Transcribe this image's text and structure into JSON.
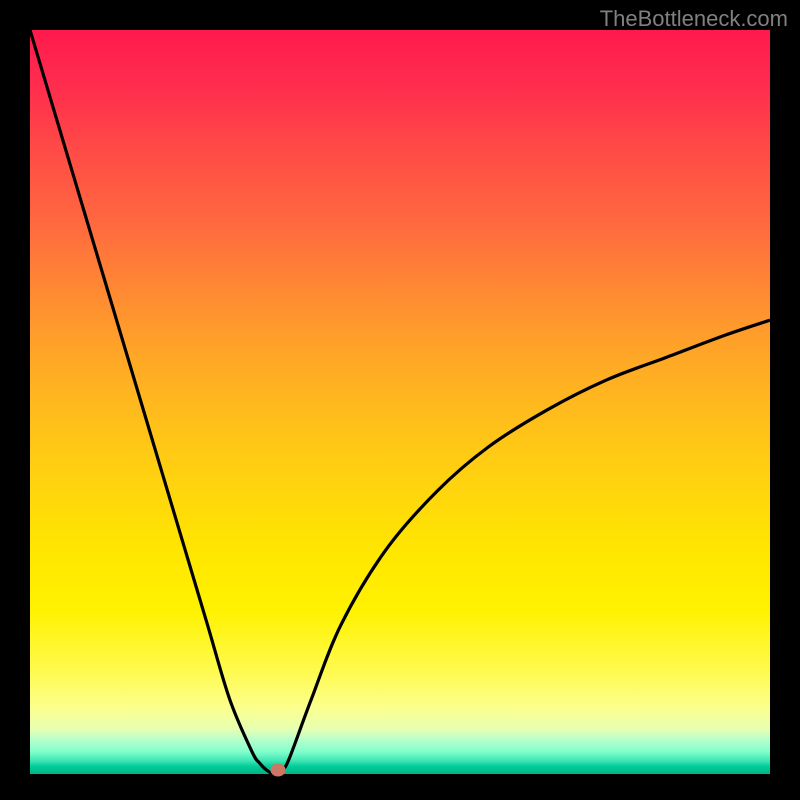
{
  "watermark": "TheBottleneck.com",
  "chart_data": {
    "type": "line",
    "title": "",
    "xlabel": "",
    "ylabel": "",
    "x": [
      0,
      3,
      6,
      9,
      12,
      15,
      18,
      21,
      24,
      27,
      30,
      31,
      32,
      33,
      34,
      35,
      38,
      42,
      48,
      55,
      62,
      70,
      78,
      86,
      94,
      100
    ],
    "values": [
      100,
      90,
      80,
      70,
      60,
      50,
      40,
      30,
      20,
      10,
      3,
      1.5,
      0.5,
      0,
      0.5,
      2,
      10,
      20,
      30,
      38,
      44,
      49,
      53,
      56,
      59,
      61
    ],
    "curve_vertex_x": 33,
    "curve_vertex_y": 0,
    "marker": {
      "x": 33.5,
      "y": 0.5
    },
    "xlim": [
      0,
      100
    ],
    "ylim": [
      0,
      100
    ],
    "gradient_meaning": "red (bad/bottleneck) to green (good/balanced)"
  }
}
